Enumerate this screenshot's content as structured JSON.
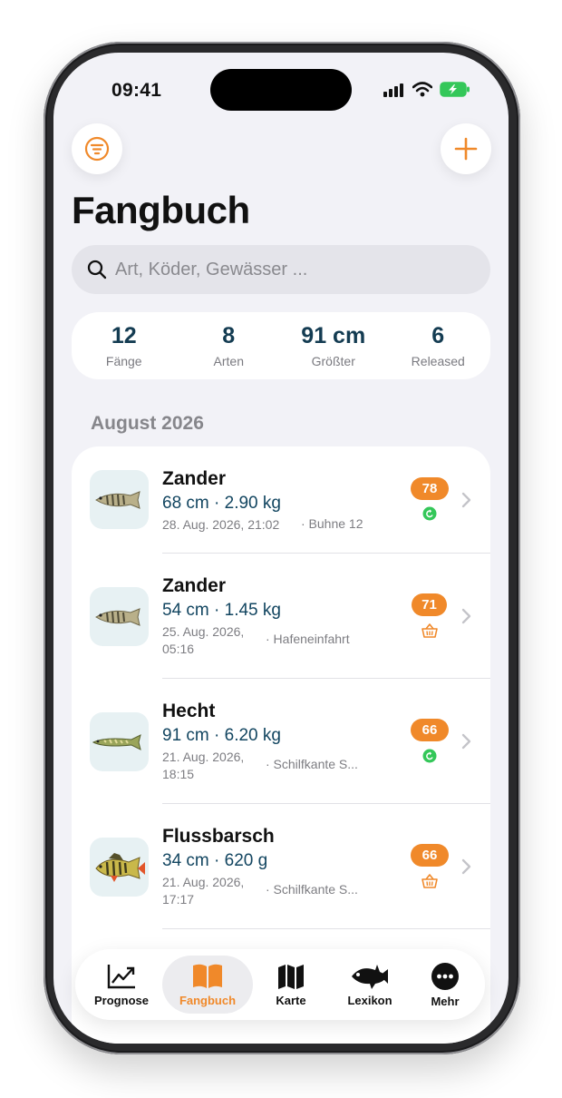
{
  "status_bar": {
    "time": "09:41"
  },
  "page": {
    "title": "Fangbuch",
    "search_placeholder": "Art, Köder, Gewässer ...",
    "filter_icon": "filter-lines-icon",
    "add_icon": "plus-icon"
  },
  "stats": [
    {
      "value": "12",
      "label": "Fänge"
    },
    {
      "value": "8",
      "label": "Arten"
    },
    {
      "value": "91 cm",
      "label": "Größter"
    },
    {
      "value": "6",
      "label": "Released"
    }
  ],
  "section": {
    "title": "August 2026"
  },
  "catches": [
    {
      "species": "Zander",
      "measure": "68 cm · 2.90 kg",
      "date_line1": "28. Aug. 2026, 21:02",
      "date_line2": "",
      "spot": "· Buhne 12",
      "score": "78",
      "status_icon": "released-icon",
      "fish_icon": "zander-fish-icon"
    },
    {
      "species": "Zander",
      "measure": "54 cm · 1.45 kg",
      "date_line1": "25. Aug. 2026,",
      "date_line2": "05:16",
      "spot": "· Hafeneinfahrt",
      "score": "71",
      "status_icon": "basket-icon",
      "fish_icon": "zander-fish-icon"
    },
    {
      "species": "Hecht",
      "measure": "91 cm · 6.20 kg",
      "date_line1": "21. Aug. 2026,",
      "date_line2": "18:15",
      "spot": "· Schilfkante S...",
      "score": "66",
      "status_icon": "released-icon",
      "fish_icon": "pike-fish-icon"
    },
    {
      "species": "Flussbarsch",
      "measure": "34 cm · 620 g",
      "date_line1": "21. Aug. 2026,",
      "date_line2": "17:17",
      "spot": "· Schilfkante S...",
      "score": "66",
      "status_icon": "basket-icon",
      "fish_icon": "perch-fish-icon"
    }
  ],
  "tabs": [
    {
      "label": "Prognose",
      "icon": "chart-trend-icon",
      "active": false
    },
    {
      "label": "Fangbuch",
      "icon": "book-icon",
      "active": true
    },
    {
      "label": "Karte",
      "icon": "map-icon",
      "active": false
    },
    {
      "label": "Lexikon",
      "icon": "fish-icon",
      "active": false
    },
    {
      "label": "Mehr",
      "icon": "more-icon",
      "active": false
    }
  ],
  "colors": {
    "accent": "#F0892A",
    "navy": "#143C52",
    "released": "#34C759",
    "background": "#F2F2F7"
  }
}
